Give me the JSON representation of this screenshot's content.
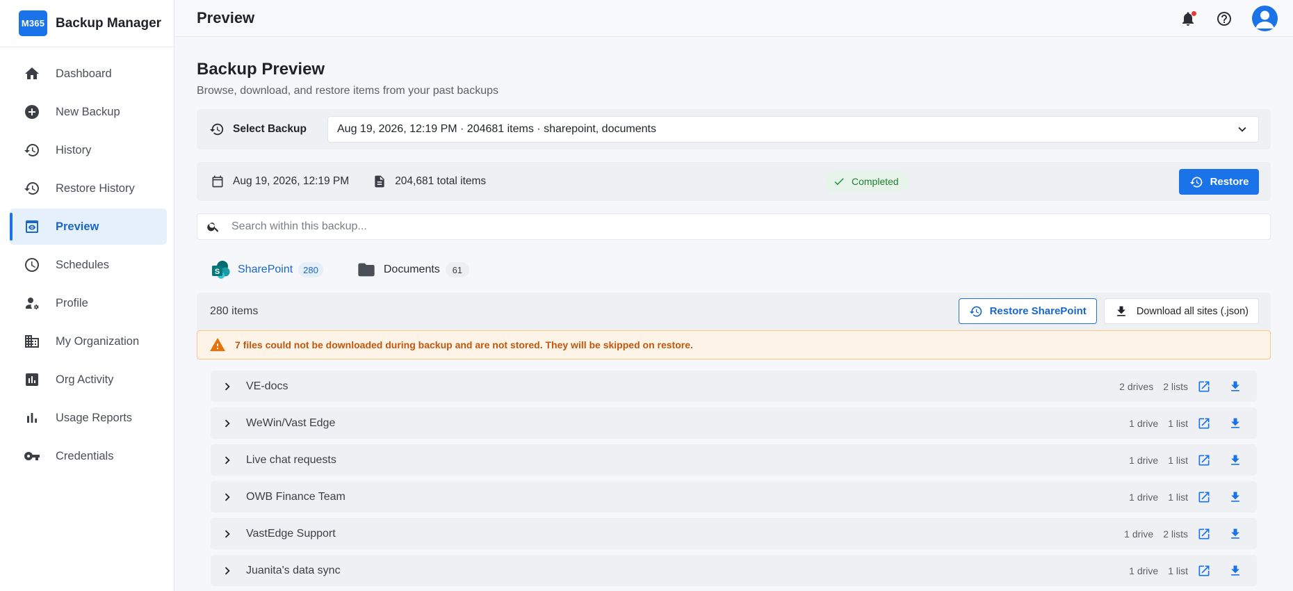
{
  "brand": {
    "logo_text": "M365",
    "name": "Backup Manager"
  },
  "sidebar": {
    "items": [
      {
        "label": "Dashboard",
        "icon": "home-icon",
        "active": false
      },
      {
        "label": "New Backup",
        "icon": "add-circle-icon",
        "active": false
      },
      {
        "label": "History",
        "icon": "history-icon",
        "active": false
      },
      {
        "label": "Restore History",
        "icon": "restore-history-icon",
        "active": false
      },
      {
        "label": "Preview",
        "icon": "preview-icon",
        "active": true
      },
      {
        "label": "Schedules",
        "icon": "clock-icon",
        "active": false
      },
      {
        "label": "Profile",
        "icon": "user-settings-icon",
        "active": false
      },
      {
        "label": "My Organization",
        "icon": "building-icon",
        "active": false
      },
      {
        "label": "Org Activity",
        "icon": "activity-chart-icon",
        "active": false
      },
      {
        "label": "Usage Reports",
        "icon": "bar-chart-icon",
        "active": false
      },
      {
        "label": "Credentials",
        "icon": "key-icon",
        "active": false
      }
    ]
  },
  "header": {
    "title": "Preview",
    "icons": [
      "bell-icon",
      "help-icon",
      "avatar"
    ]
  },
  "main": {
    "title": "Backup Preview",
    "subtitle": "Browse, download, and restore items from your past backups",
    "select_backup": {
      "label": "Select Backup",
      "value": "Aug 19, 2026, 12:19 PM · 204681 items · sharepoint, documents"
    },
    "info": {
      "date": "Aug 19, 2026, 12:19 PM",
      "total_items": "204,681 total items",
      "status": "Completed",
      "restore_label": "Restore"
    },
    "search": {
      "placeholder": "Search within this backup..."
    },
    "tabs": [
      {
        "label": "SharePoint",
        "count": "280",
        "icon": "sharepoint-icon",
        "active": true
      },
      {
        "label": "Documents",
        "count": "61",
        "icon": "folder-icon",
        "active": false
      }
    ],
    "list": {
      "count_label": "280 items",
      "restore_sharepoint_label": "Restore SharePoint",
      "download_all_label": "Download all sites (.json)"
    },
    "warning": "7 files could not be downloaded during backup and are not stored. They will be skipped on restore.",
    "sites": [
      {
        "name": "VE-docs",
        "drives": "2 drives",
        "lists": "2 lists"
      },
      {
        "name": "WeWin/Vast Edge",
        "drives": "1 drive",
        "lists": "1 list"
      },
      {
        "name": "Live chat requests",
        "drives": "1 drive",
        "lists": "1 list"
      },
      {
        "name": "OWB Finance Team",
        "drives": "1 drive",
        "lists": "1 list"
      },
      {
        "name": "VastEdge Support",
        "drives": "1 drive",
        "lists": "2 lists"
      },
      {
        "name": "Juanita's data sync",
        "drives": "1 drive",
        "lists": "1 list"
      }
    ]
  },
  "colors": {
    "accent": "#1a73e8",
    "success": "#1e8e3e",
    "warning": "#e8710a"
  }
}
